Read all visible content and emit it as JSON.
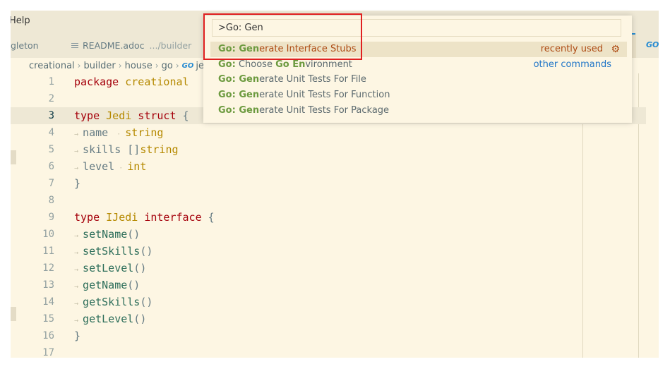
{
  "menubar": {
    "help_label": "Help"
  },
  "tabs": [
    {
      "label": "gleton"
    },
    {
      "label": "README.adoc",
      "path": ".../builder"
    }
  ],
  "go_tab_label": "GO",
  "breadcrumb": {
    "items": [
      "creational",
      "builder",
      "house",
      "go"
    ],
    "file_icon": "GO",
    "file_label": "je"
  },
  "command_palette": {
    "input_value": ">Go: Gen",
    "items": [
      {
        "hl": "Go: Gen",
        "rest": "erate Interface Stubs",
        "meta": "recently used",
        "selected": true
      },
      {
        "hl": "Go:",
        "mid": " Choose ",
        "hl2": "Go En",
        "rest": "vironment",
        "meta_link": "other commands"
      },
      {
        "hl": "Go: Gen",
        "rest": "erate Unit Tests For File"
      },
      {
        "hl": "Go: Gen",
        "rest": "erate Unit Tests For Function"
      },
      {
        "hl": "Go: Gen",
        "rest": "erate Unit Tests For Package"
      }
    ]
  },
  "editor": {
    "current_line": 3,
    "line_numbers": [
      "1",
      "2",
      "3",
      "4",
      "5",
      "6",
      "7",
      "8",
      "9",
      "10",
      "11",
      "12",
      "13",
      "14",
      "15",
      "16",
      "17"
    ],
    "code": {
      "l1_kw": "package",
      "l1_name": " creational",
      "l3_kw": "type",
      "l3_type": " Jedi",
      "l3_kw2": " struct",
      "l3_rest": " {",
      "l4_field": "name",
      "l4_type": "string",
      "l5_field": "skills",
      "l5_br": " []",
      "l5_type": "string",
      "l6_field": "level",
      "l6_type": "int",
      "l7": "}",
      "l9_kw": "type",
      "l9_type": " IJedi",
      "l9_kw2": " interface",
      "l9_rest": " {",
      "methods": [
        "setName",
        "setSkills",
        "setLevel",
        "getName",
        "getSkills",
        "getLevel"
      ],
      "parens": "()",
      "l16": "}"
    }
  },
  "colors": {
    "background": "#fdf6e3",
    "selection_text": "#ad4a12",
    "match_highlight": "#6c9a3f",
    "link": "#2176c7",
    "annotation_box": "#e02020"
  },
  "icons": {
    "gear": "gear-icon",
    "file": "readme-file-icon",
    "go": "go-file-icon"
  }
}
